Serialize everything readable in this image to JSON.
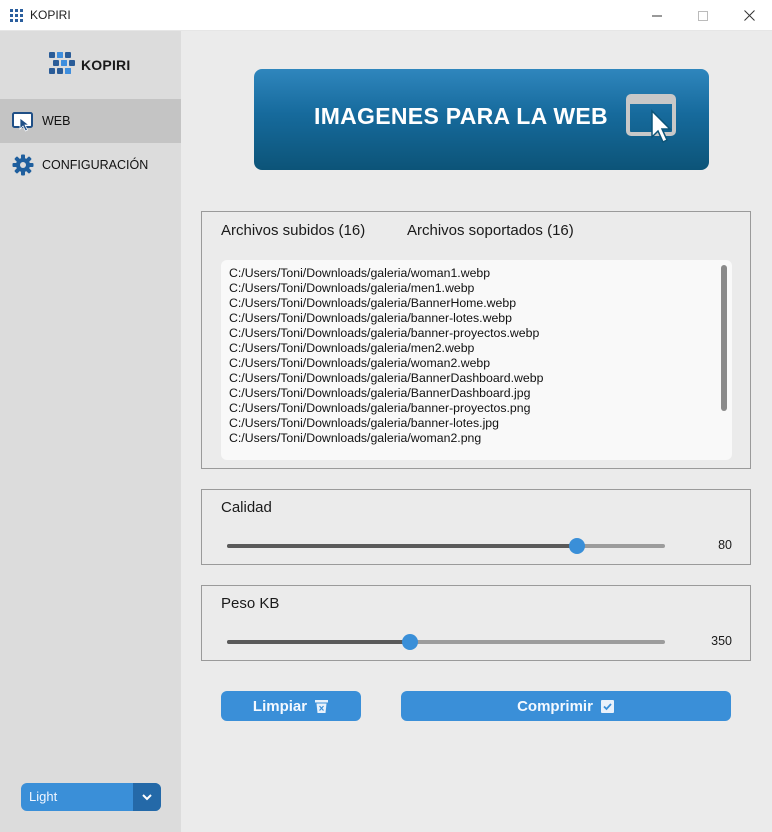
{
  "window": {
    "title": "KOPIRI"
  },
  "sidebar": {
    "brand": "KOPIRI",
    "items": [
      {
        "label": "WEB",
        "icon": "monitor-cursor-icon",
        "active": true
      },
      {
        "label": "CONFIGURACIÓN",
        "icon": "gear-icon",
        "active": false
      }
    ],
    "theme": {
      "value": "Light"
    }
  },
  "banner": {
    "text": "IMAGENES PARA LA WEB",
    "icon": "window-cursor-icon"
  },
  "files": {
    "tab_uploaded": "Archivos subidos (16)",
    "tab_supported": "Archivos soportados (16)",
    "list": [
      "C:/Users/Toni/Downloads/galeria/woman1.webp",
      "C:/Users/Toni/Downloads/galeria/men1.webp",
      "C:/Users/Toni/Downloads/galeria/BannerHome.webp",
      "C:/Users/Toni/Downloads/galeria/banner-lotes.webp",
      "C:/Users/Toni/Downloads/galeria/banner-proyectos.webp",
      "C:/Users/Toni/Downloads/galeria/men2.webp",
      "C:/Users/Toni/Downloads/galeria/woman2.webp",
      "C:/Users/Toni/Downloads/galeria/BannerDashboard.webp",
      "C:/Users/Toni/Downloads/galeria/BannerDashboard.jpg",
      "C:/Users/Toni/Downloads/galeria/banner-proyectos.png",
      "C:/Users/Toni/Downloads/galeria/banner-lotes.jpg",
      "C:/Users/Toni/Downloads/galeria/woman2.png"
    ]
  },
  "quality": {
    "label": "Calidad",
    "value": "80",
    "fraction": 0.8
  },
  "weight": {
    "label": "Peso KB",
    "value": "350",
    "fraction": 0.417
  },
  "buttons": {
    "clear": "Limpiar",
    "compress": "Comprimir"
  },
  "colors": {
    "accent": "#3a8fd8",
    "banner": "#166a9c",
    "sidebar": "#dcdcdc"
  }
}
